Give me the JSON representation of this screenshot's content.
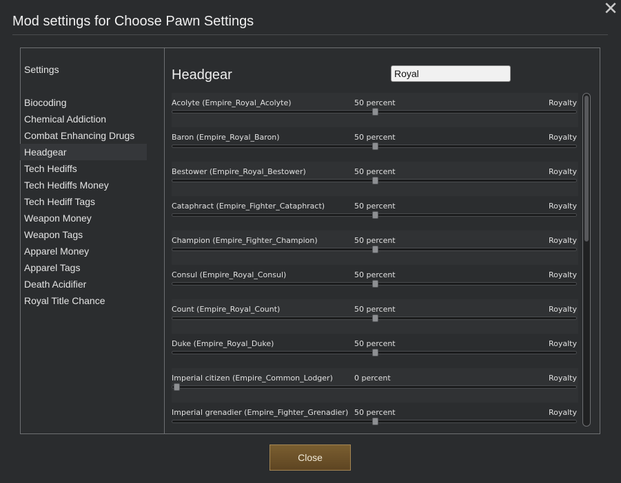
{
  "window": {
    "title": "Mod settings for Choose Pawn Settings",
    "close_glyph": "✕"
  },
  "sidebar": {
    "heading": "Settings",
    "items": [
      {
        "label": "Biocoding"
      },
      {
        "label": "Chemical Addiction"
      },
      {
        "label": "Combat Enhancing Drugs"
      },
      {
        "label": "Headgear",
        "active": true
      },
      {
        "label": "Tech Hediffs"
      },
      {
        "label": "Tech Hediffs Money"
      },
      {
        "label": "Tech Hediff Tags"
      },
      {
        "label": "Weapon Money"
      },
      {
        "label": "Weapon Tags"
      },
      {
        "label": "Apparel Money"
      },
      {
        "label": "Apparel Tags"
      },
      {
        "label": "Death Acidifier"
      },
      {
        "label": "Royal Title Chance"
      }
    ]
  },
  "main": {
    "section_title": "Headgear",
    "search": {
      "value": "Royal",
      "placeholder": ""
    },
    "rows": [
      {
        "label": "Acolyte (Empire_Royal_Acolyte)",
        "percent": "50 percent",
        "value": 50,
        "tag": "Royalty"
      },
      {
        "label": "Baron (Empire_Royal_Baron)",
        "percent": "50 percent",
        "value": 50,
        "tag": "Royalty"
      },
      {
        "label": "Bestower (Empire_Royal_Bestower)",
        "percent": "50 percent",
        "value": 50,
        "tag": "Royalty"
      },
      {
        "label": "Cataphract (Empire_Fighter_Cataphract)",
        "percent": "50 percent",
        "value": 50,
        "tag": "Royalty"
      },
      {
        "label": "Champion (Empire_Fighter_Champion)",
        "percent": "50 percent",
        "value": 50,
        "tag": "Royalty"
      },
      {
        "label": "Consul (Empire_Royal_Consul)",
        "percent": "50 percent",
        "value": 50,
        "tag": "Royalty"
      },
      {
        "label": "Count (Empire_Royal_Count)",
        "percent": "50 percent",
        "value": 50,
        "tag": "Royalty"
      },
      {
        "label": "Duke (Empire_Royal_Duke)",
        "percent": "50 percent",
        "value": 50,
        "tag": "Royalty"
      },
      {
        "label": "Imperial citizen (Empire_Common_Lodger)",
        "percent": "0 percent",
        "value": 0,
        "tag": "Royalty"
      },
      {
        "label": "Imperial grenadier (Empire_Fighter_Grenadier)",
        "percent": "50 percent",
        "value": 50,
        "tag": "Royalty"
      }
    ]
  },
  "footer": {
    "close_label": "Close"
  }
}
